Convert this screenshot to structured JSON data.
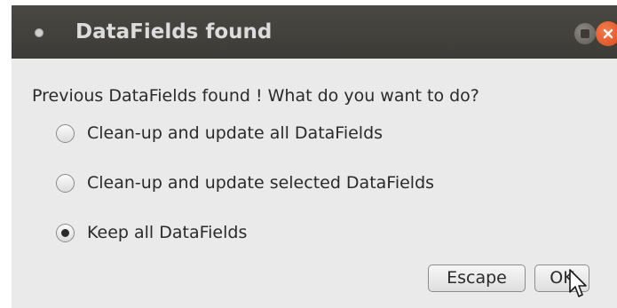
{
  "window": {
    "title": "DataFields found"
  },
  "dialog": {
    "message": "Previous DataFields found ! What do you want to do?",
    "options": [
      {
        "label": "Clean-up and update all DataFields",
        "checked": false
      },
      {
        "label": "Clean-up and update selected DataFields",
        "checked": false
      },
      {
        "label": "Keep all DataFields",
        "checked": true
      }
    ],
    "escape_label": "Escape",
    "ok_label": "OK"
  },
  "colors": {
    "titlebar": "#3d3b37",
    "close_button": "#e05a28",
    "dialog_background": "#eaeaea"
  }
}
